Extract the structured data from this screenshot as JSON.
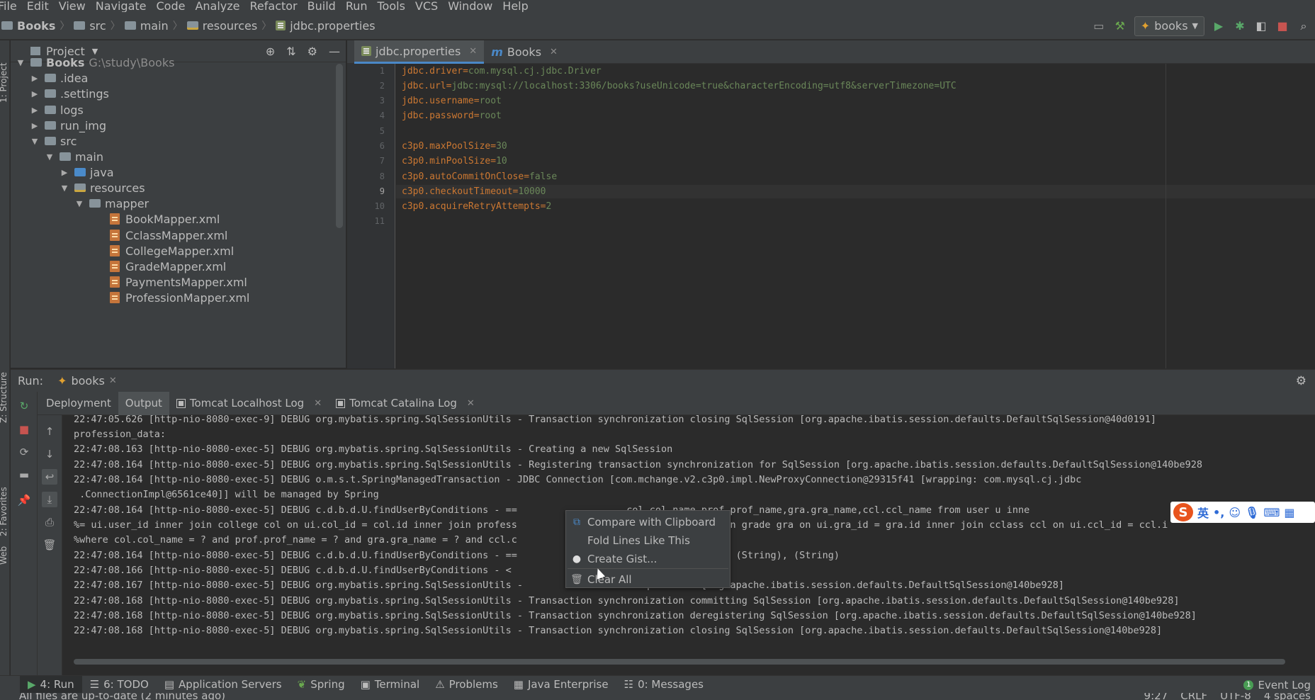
{
  "menu": [
    "File",
    "Edit",
    "View",
    "Navigate",
    "Code",
    "Analyze",
    "Refactor",
    "Build",
    "Run",
    "Tools",
    "VCS",
    "Window",
    "Help"
  ],
  "breadcrumb": [
    "Books",
    "src",
    "main",
    "resources",
    "jdbc.properties"
  ],
  "run_config": "books",
  "project": {
    "title": "Project",
    "root_name": "Books",
    "root_path": "G:\\study\\Books",
    "items": [
      {
        "label": "Books"
      },
      {
        "label": ".idea"
      },
      {
        "label": ".settings"
      },
      {
        "label": "logs"
      },
      {
        "label": "run_img"
      },
      {
        "label": "src"
      },
      {
        "label": "main"
      },
      {
        "label": "java"
      },
      {
        "label": "resources"
      },
      {
        "label": "mapper"
      },
      {
        "label": "BookMapper.xml"
      },
      {
        "label": "CclassMapper.xml"
      },
      {
        "label": "CollegeMapper.xml"
      },
      {
        "label": "GradeMapper.xml"
      },
      {
        "label": "PaymentsMapper.xml"
      },
      {
        "label": "ProfessionMapper.xml"
      }
    ]
  },
  "editor": {
    "tabs": [
      {
        "label": "jdbc.properties"
      },
      {
        "label": "Books"
      }
    ],
    "line_numbers": [
      "1",
      "2",
      "3",
      "4",
      "5",
      "6",
      "7",
      "8",
      "9",
      "10",
      "11"
    ],
    "lines": [
      {
        "key": "jdbc.driver",
        "value": "com.mysql.cj.jdbc.Driver"
      },
      {
        "key": "jdbc.url",
        "value": "jdbc:mysql://localhost:3306/books?useUnicode=true&characterEncoding=utf8&serverTimezone=UTC"
      },
      {
        "key": "jdbc.username",
        "value": "root"
      },
      {
        "key": "jdbc.password",
        "value": "root"
      },
      {
        "key": "",
        "value": ""
      },
      {
        "key": "c3p0.maxPoolSize",
        "value": "30"
      },
      {
        "key": "c3p0.minPoolSize",
        "value": "10"
      },
      {
        "key": "c3p0.autoCommitOnClose",
        "value": "false"
      },
      {
        "key": "c3p0.checkoutTimeout",
        "value": "10000"
      },
      {
        "key": "c3p0.acquireRetryAttempts",
        "value": "2"
      }
    ]
  },
  "run": {
    "label": "Run:",
    "config": "books",
    "tabs": [
      {
        "label": "Deployment"
      },
      {
        "label": "Output"
      },
      {
        "label": "Tomcat Localhost Log"
      },
      {
        "label": "Tomcat Catalina Log"
      }
    ],
    "console": [
      "22:47:05.626 [http-nio-8080-exec-9] DEBUG org.mybatis.spring.SqlSessionUtils - Transaction synchronization closing SqlSession [org.apache.ibatis.session.defaults.DefaultSqlSession@40d0191]",
      "profession_data:",
      "22:47:08.163 [http-nio-8080-exec-5] DEBUG org.mybatis.spring.SqlSessionUtils - Creating a new SqlSession",
      "22:47:08.164 [http-nio-8080-exec-5] DEBUG org.mybatis.spring.SqlSessionUtils - Registering transaction synchronization for SqlSession [org.apache.ibatis.session.defaults.DefaultSqlSession@140be928",
      "22:47:08.164 [http-nio-8080-exec-5] DEBUG o.m.s.t.SpringManagedTransaction - JDBC Connection [com.mchange.v2.c3p0.impl.NewProxyConnection@29315f41 [wrapping: com.mysql.cj.jdbc",
      " .ConnectionImpl@6561ce40]] will be managed by Spring",
      "22:47:08.164 [http-nio-8080-exec-5] DEBUG c.d.b.d.U.findUserByConditions - ==                   col.col_name,prof.prof_name,gra.gra_name,ccl.ccl_name from user u inne",
      "%= ui.user_id inner join college col on ui.col_id = col.id inner join profess                     rof.id inner join grade gra on ui.gra_id = gra.id inner join cclass ccl on ui.ccl_id = ccl.i",
      "%where col.col_name = ? and prof.prof_name = ? and gra.gra_name = ? and ccl.c",
      "22:47:08.164 [http-nio-8080-exec-5] DEBUG c.d.b.d.U.findUserByConditions - ==                   String), (String), (String), (String)",
      "22:47:08.166 [http-nio-8080-exec-5] DEBUG c.d.b.d.U.findUserByConditions - <",
      "22:47:08.167 [http-nio-8080-exec-5] DEBUG org.mybatis.spring.SqlSessionUtils -                    SqlSession [org.apache.ibatis.session.defaults.DefaultSqlSession@140be928]",
      "22:47:08.168 [http-nio-8080-exec-5] DEBUG org.mybatis.spring.SqlSessionUtils - Transaction synchronization committing SqlSession [org.apache.ibatis.session.defaults.DefaultSqlSession@140be928]",
      "22:47:08.168 [http-nio-8080-exec-5] DEBUG org.mybatis.spring.SqlSessionUtils - Transaction synchronization deregistering SqlSession [org.apache.ibatis.session.defaults.DefaultSqlSession@140be928]",
      "22:47:08.168 [http-nio-8080-exec-5] DEBUG org.mybatis.spring.SqlSessionUtils - Transaction synchronization closing SqlSession [org.apache.ibatis.session.defaults.DefaultSqlSession@140be928]"
    ]
  },
  "context_menu": [
    {
      "label": "Compare with Clipboard",
      "icon": "compare-icon"
    },
    {
      "label": "Fold Lines Like This",
      "icon": ""
    },
    {
      "label": "Create Gist...",
      "icon": "github-icon"
    },
    {
      "label": "Clear All",
      "icon": "trash-icon"
    }
  ],
  "ime": {
    "lang": "英"
  },
  "side_tabs": [
    "1: Project",
    "Z: Structure",
    "2: Favorites",
    "Web"
  ],
  "bottom_tabs": [
    {
      "label": "4: Run"
    },
    {
      "label": "6: TODO"
    },
    {
      "label": "Application Servers"
    },
    {
      "label": "Spring"
    },
    {
      "label": "Terminal"
    },
    {
      "label": "Problems"
    },
    {
      "label": "Java Enterprise"
    },
    {
      "label": "0: Messages"
    }
  ],
  "event_log": {
    "count": "1",
    "label": "Event Log"
  },
  "status": {
    "message": "All files are up-to-date (2 minutes ago)",
    "position": "9:27",
    "line_sep": "CRLF",
    "encoding": "UTF-8",
    "indent": "4 spaces"
  },
  "colors": {
    "accent": "#4a88c7",
    "key": "#cc7832",
    "value": "#6a8759"
  }
}
